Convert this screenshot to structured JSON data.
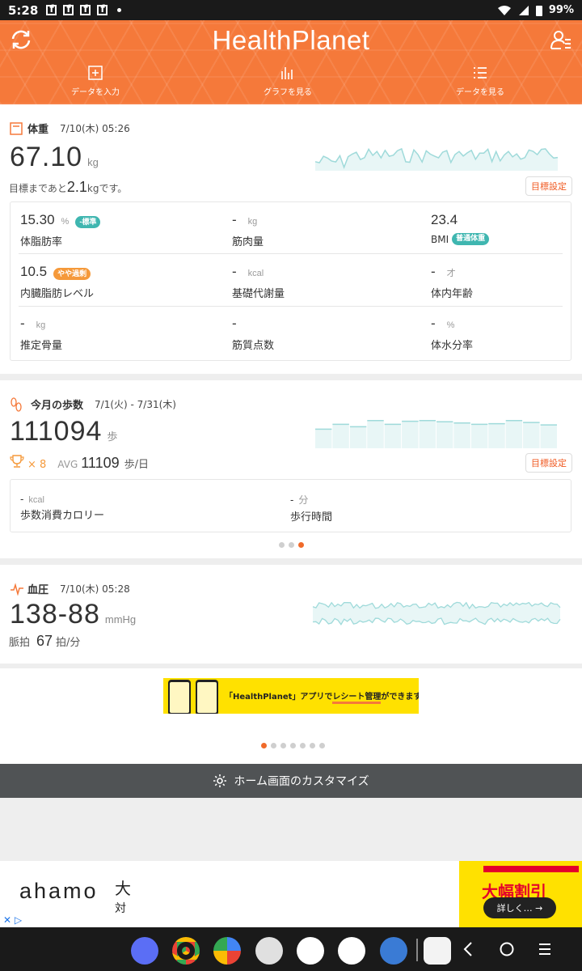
{
  "status_bar": {
    "time": "5:28",
    "battery": "99%"
  },
  "header": {
    "title": "HealthPlanet",
    "nav": [
      {
        "label": "データを入力",
        "icon": "plus-square-icon"
      },
      {
        "label": "グラフを見る",
        "icon": "bar-graph-icon"
      },
      {
        "label": "データを見る",
        "icon": "list-icon"
      }
    ]
  },
  "weight": {
    "title": "体重",
    "date": "7/10(木) 05:26",
    "value": "67.10",
    "unit": "kg",
    "goal_prefix": "目標まであと",
    "goal_value": "2.1",
    "goal_unit": "kg",
    "goal_suffix": "です。",
    "goal_button": "目標設定",
    "metrics": [
      {
        "value": "15.30",
        "unit": "%",
        "label": "体脂肪率",
        "badge": "-標準",
        "badge_color": "#3fb6b0"
      },
      {
        "value": "-",
        "unit": "kg",
        "label": "筋肉量"
      },
      {
        "value": "23.4",
        "unit": "",
        "label": "BMI",
        "badge": "普通体重",
        "badge_color": "#3fb6b0"
      },
      {
        "value": "10.5",
        "unit": "",
        "label": "内臓脂肪レベル",
        "badge": "やや過剰",
        "badge_color": "#f5993a"
      },
      {
        "value": "-",
        "unit": "kcal",
        "label": "基礎代謝量"
      },
      {
        "value": "-",
        "unit": "才",
        "label": "体内年齢"
      },
      {
        "value": "-",
        "unit": "kg",
        "label": "推定骨量"
      },
      {
        "value": "-",
        "unit": "",
        "label": "筋質点数"
      },
      {
        "value": "-",
        "unit": "%",
        "label": "体水分率"
      }
    ]
  },
  "steps": {
    "title": "今月の歩数",
    "date": "7/1(火) - 7/31(木)",
    "value": "111094",
    "unit": "歩",
    "trophy_count": "× 8",
    "avg_label": "AVG",
    "avg_value": "11109",
    "avg_unit": "歩/日",
    "goal_button": "目標設定",
    "metrics": [
      {
        "value": "-",
        "unit": "kcal",
        "label": "歩数消費カロリー"
      },
      {
        "value": "-",
        "unit": "分",
        "label": "歩行時間"
      }
    ],
    "bars": [
      0.62,
      0.78,
      0.7,
      0.9,
      0.78,
      0.88,
      0.9,
      0.86,
      0.82,
      0.78,
      0.8,
      0.9,
      0.84,
      0.76
    ]
  },
  "pressure": {
    "title": "血圧",
    "date": "7/10(木) 05:28",
    "value": "138-88",
    "unit": "mmHg",
    "pulse_label": "脈拍",
    "pulse_value": "67",
    "pulse_unit": "拍/分"
  },
  "banner": {
    "text_a": "「HealthPlanet」アプリで",
    "text_b": "レシート管理",
    "text_c": "ができます!"
  },
  "customize": {
    "label": "ホーム画面のカスタマイズ"
  },
  "ad": {
    "brand": "ahamo",
    "line1": "大",
    "line2": "対",
    "promo": "大幅割引",
    "button": "詳しく… →"
  },
  "colors": {
    "accent": "#f5793a",
    "teal": "#3fb6b0",
    "spark": "#9fdada"
  }
}
